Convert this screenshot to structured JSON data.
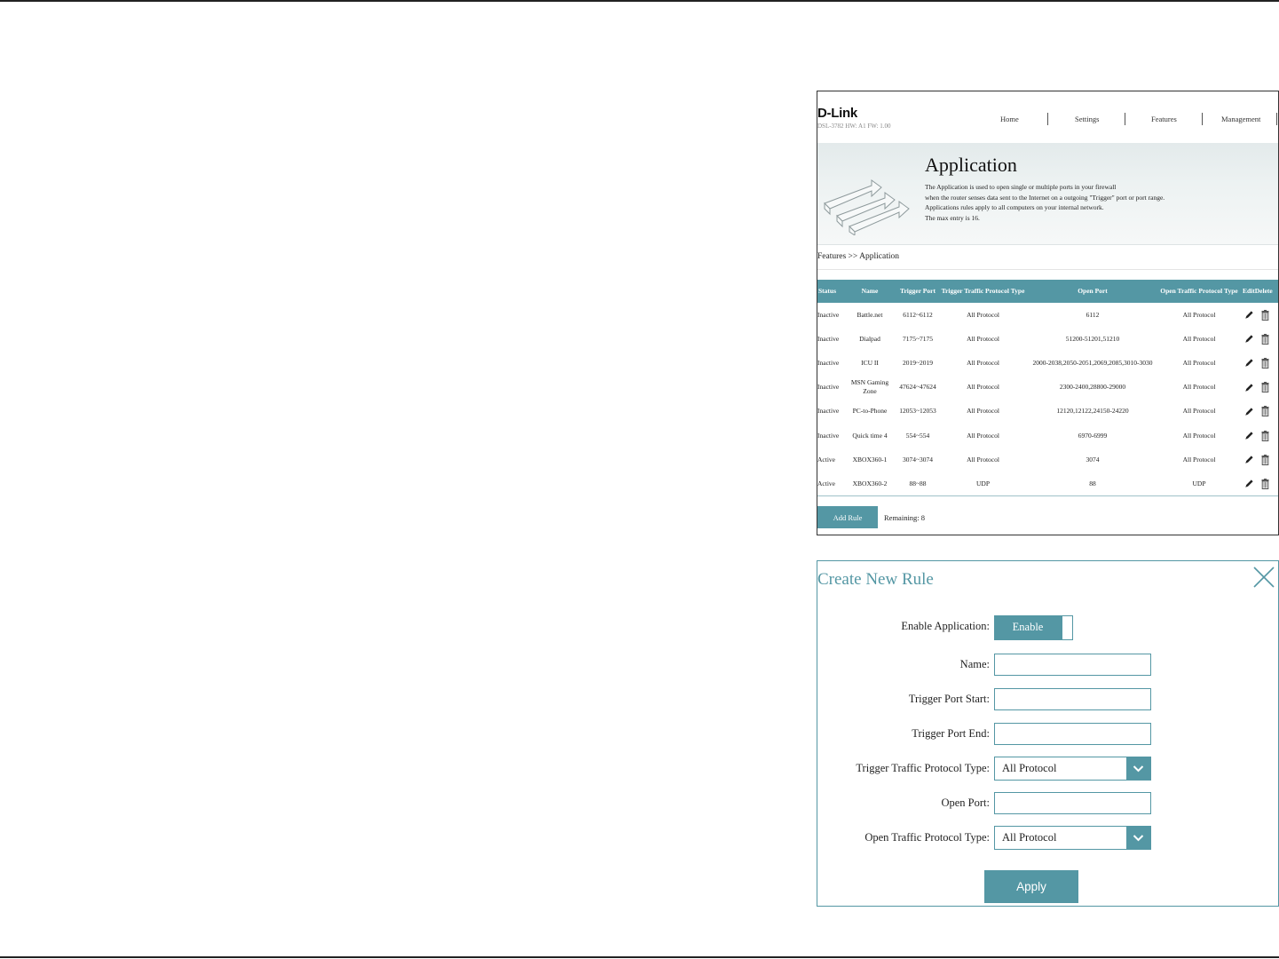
{
  "app": {
    "logo": "D-Link",
    "model": "DSL-3782  HW: A1  FW: 1.00",
    "nav": [
      "Home",
      "Settings",
      "Features",
      "Management"
    ],
    "title": "Application",
    "description": [
      "The Application is used to open single or multiple ports in your firewall",
      "when the router senses data sent to the Internet on a outgoing \"Trigger\" port or port range.",
      "Applications rules apply to all computers on your internal network.",
      "The max entry is 16."
    ],
    "breadcrumb": "Features >> Application",
    "table": {
      "headers": [
        "Status",
        "Name",
        "Trigger Port",
        "Trigger Traffic Protocol Type",
        "Open Port",
        "Open Traffic Protocol Type",
        "Edit",
        "Delete"
      ],
      "rows": [
        {
          "status": "Inactive",
          "name": "Battle.net",
          "trigger_port": "6112~6112",
          "trigger_proto": "All Protocol",
          "open_port": "6112",
          "open_proto": "All Protocol"
        },
        {
          "status": "Inactive",
          "name": "Dialpad",
          "trigger_port": "7175~7175",
          "trigger_proto": "All Protocol",
          "open_port": "51200-51201,51210",
          "open_proto": "All Protocol"
        },
        {
          "status": "Inactive",
          "name": "ICU II",
          "trigger_port": "2019~2019",
          "trigger_proto": "All Protocol",
          "open_port": "2000-2038,2050-2051,2069,2085,3010-3030",
          "open_proto": "All Protocol"
        },
        {
          "status": "Inactive",
          "name": "MSN Gaming Zone",
          "trigger_port": "47624~47624",
          "trigger_proto": "All Protocol",
          "open_port": "2300-2400,28800-29000",
          "open_proto": "All Protocol"
        },
        {
          "status": "Inactive",
          "name": "PC-to-Phone",
          "trigger_port": "12053~12053",
          "trigger_proto": "All Protocol",
          "open_port": "12120,12122,24150-24220",
          "open_proto": "All Protocol"
        },
        {
          "status": "Inactive",
          "name": "Quick time 4",
          "trigger_port": "554~554",
          "trigger_proto": "All Protocol",
          "open_port": "6970-6999",
          "open_proto": "All Protocol"
        },
        {
          "status": "Active",
          "name": "XBOX360-1",
          "trigger_port": "3074~3074",
          "trigger_proto": "All Protocol",
          "open_port": "3074",
          "open_proto": "All Protocol"
        },
        {
          "status": "Active",
          "name": "XBOX360-2",
          "trigger_port": "88~88",
          "trigger_proto": "UDP",
          "open_port": "88",
          "open_proto": "UDP"
        }
      ]
    },
    "add_rule_label": "Add Rule",
    "remaining": "Remaining: 8"
  },
  "create_rule": {
    "title": "Create New Rule",
    "enable_label": "Enable Application:",
    "enable_value": "Enable",
    "name_label": "Name:",
    "name_value": "",
    "trigger_start_label": "Trigger Port Start:",
    "trigger_start_value": "",
    "trigger_end_label": "Trigger Port End:",
    "trigger_end_value": "",
    "trigger_proto_label": "Trigger Traffic Protocol Type:",
    "trigger_proto_value": "All Protocol",
    "open_port_label": "Open Port:",
    "open_port_value": "",
    "open_proto_label": "Open Traffic Protocol Type:",
    "open_proto_value": "All Protocol",
    "apply_label": "Apply"
  },
  "icons": {
    "edit": "pencil-icon",
    "delete": "trash-icon",
    "close": "close-icon",
    "dropdown": "chevron-down-icon",
    "banner": "port-arrows-illustration"
  },
  "colors": {
    "accent": "#5497a4",
    "inactive": "#d0342c",
    "active": "#2a45a8"
  }
}
